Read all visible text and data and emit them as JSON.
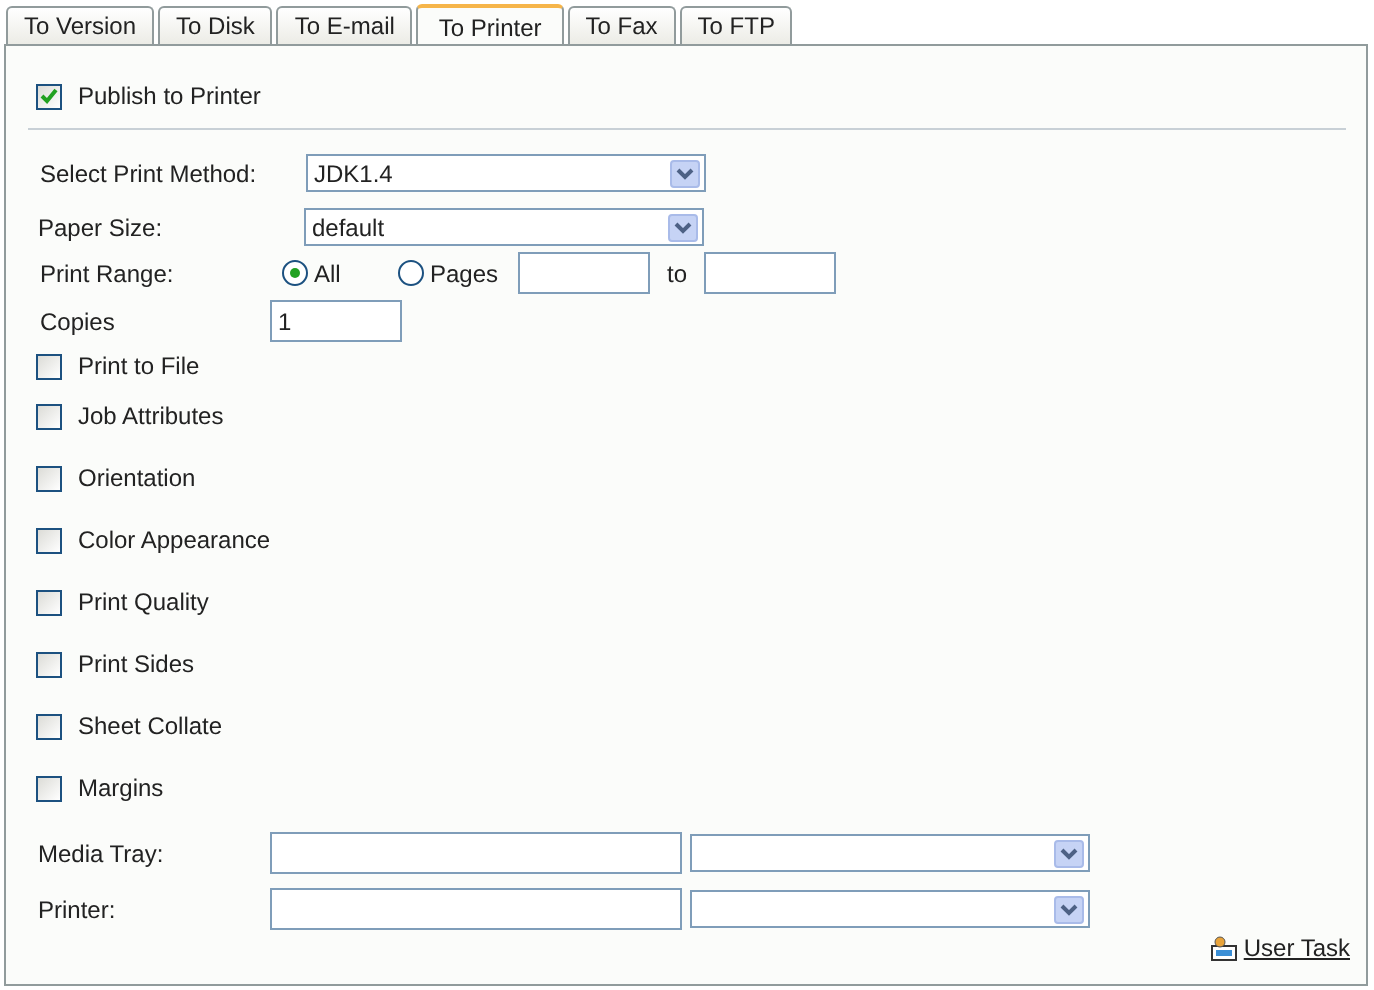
{
  "tabs": [
    {
      "label": "To Version",
      "selected": false
    },
    {
      "label": "To Disk",
      "selected": false
    },
    {
      "label": "To E-mail",
      "selected": false
    },
    {
      "label": "To Printer",
      "selected": true
    },
    {
      "label": "To Fax",
      "selected": false
    },
    {
      "label": "To FTP",
      "selected": false
    }
  ],
  "publish": {
    "label": "Publish to Printer",
    "checked": true
  },
  "print_method": {
    "label": "Select Print Method:",
    "value": "JDK1.4"
  },
  "paper_size": {
    "label": "Paper Size:",
    "value": "default"
  },
  "print_range": {
    "label": "Print Range:",
    "options": [
      {
        "label": "All",
        "selected": true
      },
      {
        "label": "Pages",
        "selected": false
      }
    ],
    "to_label": "to"
  },
  "copies": {
    "label": "Copies",
    "value": "1"
  },
  "options": [
    {
      "label": "Print to File",
      "checked": false
    },
    {
      "label": "Job Attributes",
      "checked": false
    },
    {
      "label": "Orientation",
      "checked": false
    },
    {
      "label": "Color Appearance",
      "checked": false
    },
    {
      "label": "Print Quality",
      "checked": false
    },
    {
      "label": "Print Sides",
      "checked": false
    },
    {
      "label": "Sheet Collate",
      "checked": false
    },
    {
      "label": "Margins",
      "checked": false
    }
  ],
  "media_tray": {
    "label": "Media Tray:"
  },
  "printer": {
    "label": "Printer:"
  },
  "user_task": {
    "label": "User Task"
  }
}
